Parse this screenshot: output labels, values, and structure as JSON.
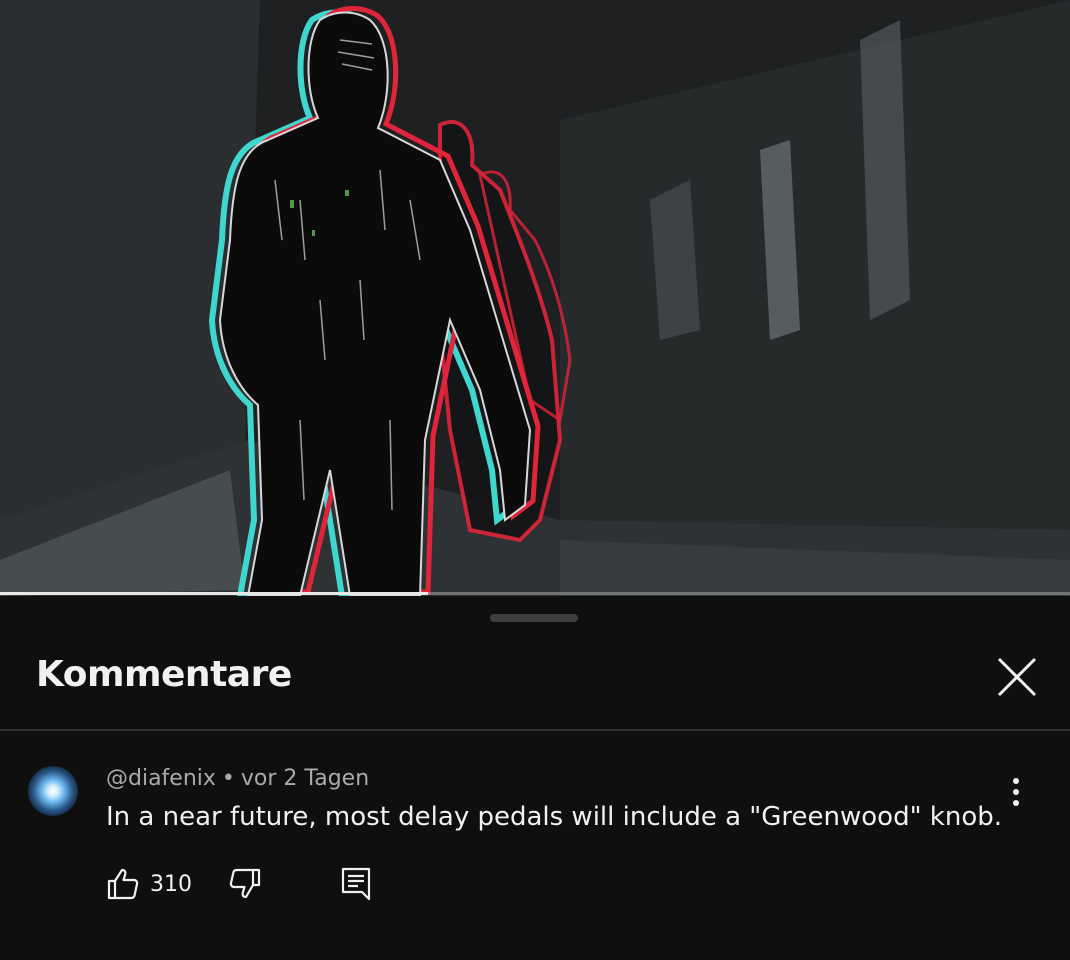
{
  "video": {
    "progress": 0.4
  },
  "comments_panel": {
    "title": "Kommentare",
    "close_icon": "close-icon",
    "comments": [
      {
        "author": "@diafenix",
        "separator": "•",
        "time": "vor 2 Tagen",
        "text": "In a near future, most delay pedals will include a \"Greenwood\" knob.",
        "likes": "310",
        "icons": [
          "thumbs-up-icon",
          "thumbs-down-icon",
          "reply-icon",
          "more-vert-icon"
        ]
      }
    ]
  },
  "colors": {
    "background": "#0f0f0f",
    "text_primary": "#f1f1f1",
    "text_secondary": "#aaaaaa",
    "divider": "#303030",
    "outline_cyan": "#3fd6d0",
    "outline_red": "#e0243a"
  }
}
